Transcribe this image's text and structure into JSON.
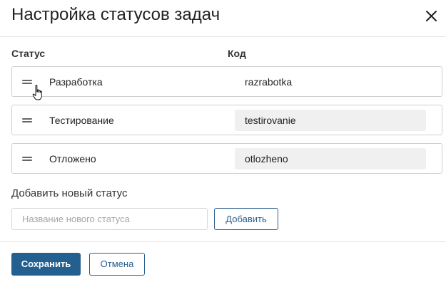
{
  "dialog": {
    "title": "Настройка статусов задач",
    "close_icon": "close-icon"
  },
  "columns": {
    "status": "Статус",
    "code": "Код"
  },
  "statuses": [
    {
      "label": "Разработка",
      "code": "razrabotka"
    },
    {
      "label": "Тестирование",
      "code": "testirovanie"
    },
    {
      "label": "Отложено",
      "code": "otlozheno"
    }
  ],
  "add_section": {
    "title": "Добавить новый статус",
    "input_value": "",
    "input_placeholder": "Название нового статуса",
    "add_button": "Добавить"
  },
  "footer": {
    "save_button": "Сохранить",
    "cancel_button": "Отмена"
  },
  "colors": {
    "accent": "#235f8f",
    "code_field_bg": "#f0f0f0",
    "border": "#cfcfcf"
  }
}
